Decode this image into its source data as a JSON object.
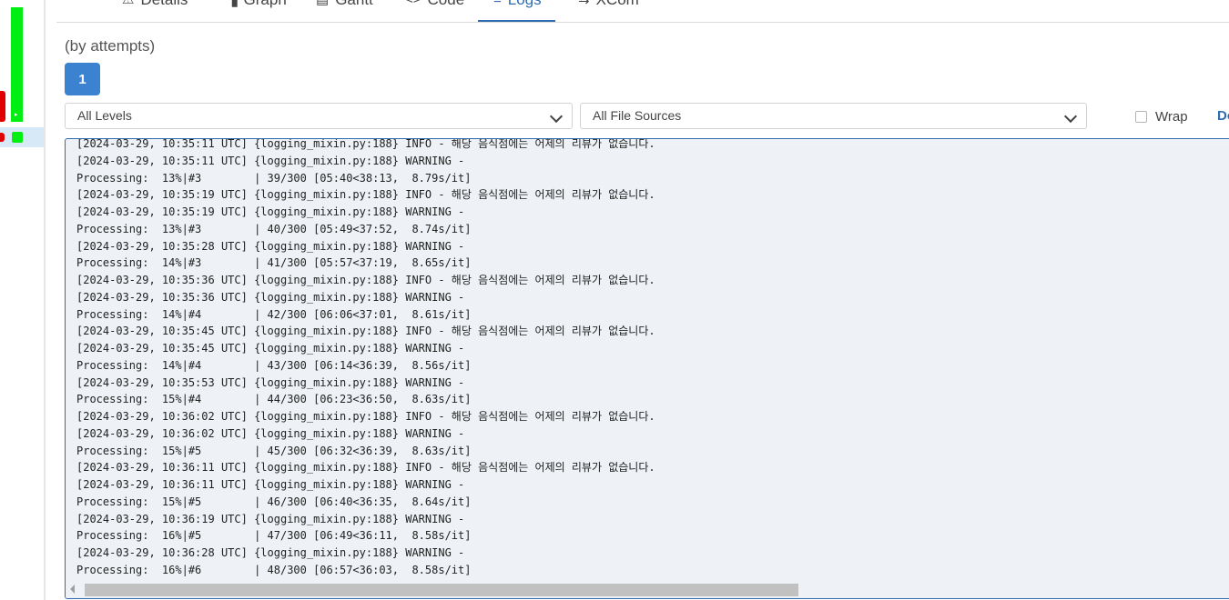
{
  "tabs": [
    {
      "icon": "⚠",
      "label": "Details"
    },
    {
      "icon": "▚",
      "label": "Graph"
    },
    {
      "icon": "▤",
      "label": "Gantt"
    },
    {
      "icon": "<>",
      "label": "Code"
    },
    {
      "icon": "≡",
      "label": "Logs"
    },
    {
      "icon": "⇆",
      "label": "XCom"
    }
  ],
  "active_tab": "Logs",
  "attempts": {
    "title": "(by attempts)",
    "buttons": [
      "1"
    ]
  },
  "filters": {
    "level": "All Levels",
    "source": "All File Sources"
  },
  "wrap_label": "Wrap",
  "download_label": "Do",
  "colors": {
    "accent": "#2f6db0",
    "success": "#00ee11",
    "failed": "#e00000",
    "log_bg": "#eef2f6"
  },
  "log_lines": [
    "[2024-03-29, 10:35:11 UTC] {logging_mixin.py:188} INFO - 해당 음식점에는 어제의 리뷰가 없습니다.",
    "[2024-03-29, 10:35:11 UTC] {logging_mixin.py:188} WARNING -",
    "Processing:  13%|#3        | 39/300 [05:40<38:13,  8.79s/it]",
    "[2024-03-29, 10:35:19 UTC] {logging_mixin.py:188} INFO - 해당 음식점에는 어제의 리뷰가 없습니다.",
    "[2024-03-29, 10:35:19 UTC] {logging_mixin.py:188} WARNING -",
    "Processing:  13%|#3        | 40/300 [05:49<37:52,  8.74s/it]",
    "[2024-03-29, 10:35:28 UTC] {logging_mixin.py:188} WARNING -",
    "Processing:  14%|#3        | 41/300 [05:57<37:19,  8.65s/it]",
    "[2024-03-29, 10:35:36 UTC] {logging_mixin.py:188} INFO - 해당 음식점에는 어제의 리뷰가 없습니다.",
    "[2024-03-29, 10:35:36 UTC] {logging_mixin.py:188} WARNING -",
    "Processing:  14%|#4        | 42/300 [06:06<37:01,  8.61s/it]",
    "[2024-03-29, 10:35:45 UTC] {logging_mixin.py:188} INFO - 해당 음식점에는 어제의 리뷰가 없습니다.",
    "[2024-03-29, 10:35:45 UTC] {logging_mixin.py:188} WARNING -",
    "Processing:  14%|#4        | 43/300 [06:14<36:39,  8.56s/it]",
    "[2024-03-29, 10:35:53 UTC] {logging_mixin.py:188} WARNING -",
    "Processing:  15%|#4        | 44/300 [06:23<36:50,  8.63s/it]",
    "[2024-03-29, 10:36:02 UTC] {logging_mixin.py:188} INFO - 해당 음식점에는 어제의 리뷰가 없습니다.",
    "[2024-03-29, 10:36:02 UTC] {logging_mixin.py:188} WARNING -",
    "Processing:  15%|#5        | 45/300 [06:32<36:39,  8.63s/it]",
    "[2024-03-29, 10:36:11 UTC] {logging_mixin.py:188} INFO - 해당 음식점에는 어제의 리뷰가 없습니다.",
    "[2024-03-29, 10:36:11 UTC] {logging_mixin.py:188} WARNING -",
    "Processing:  15%|#5        | 46/300 [06:40<36:35,  8.64s/it]",
    "[2024-03-29, 10:36:19 UTC] {logging_mixin.py:188} WARNING -",
    "Processing:  16%|#5        | 47/300 [06:49<36:11,  8.58s/it]",
    "[2024-03-29, 10:36:28 UTC] {logging_mixin.py:188} WARNING -",
    "Processing:  16%|#6        | 48/300 [06:57<36:03,  8.58s/it]"
  ]
}
